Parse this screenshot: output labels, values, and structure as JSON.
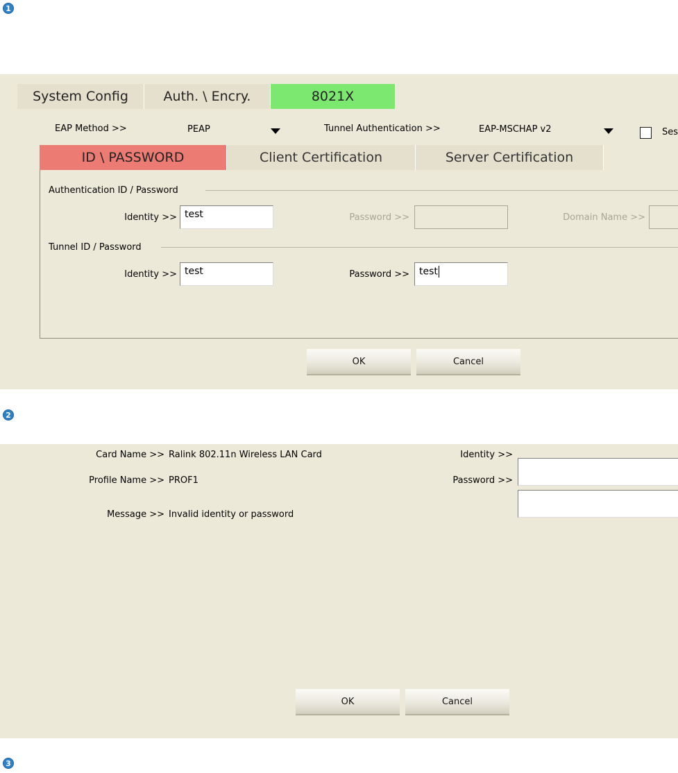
{
  "steps": [
    "1",
    "2",
    "3"
  ],
  "config_tabs": [
    "System Config",
    "Auth. \\ Encry.",
    "8021X"
  ],
  "eap": {
    "method_label": "EAP Method >>",
    "method_value": "PEAP",
    "tunnel_label": "Tunnel Authentication >>",
    "tunnel_value": "EAP-MSCHAP v2",
    "session_label": "Ses"
  },
  "sub_tabs": [
    "ID \\ PASSWORD",
    "Client Certification",
    "Server Certification"
  ],
  "auth_group": {
    "title": "Authentication ID / Password",
    "identity_label": "Identity >>",
    "identity_value": "test",
    "password_label": "Password >>",
    "password_value": "",
    "domain_label": "Domain Name >>",
    "domain_value": ""
  },
  "tunnel_group": {
    "title": "Tunnel ID / Password",
    "identity_label": "Identity >>",
    "identity_value": "test",
    "password_label": "Password >>",
    "password_value": "test"
  },
  "dialog1": {
    "ok": "OK",
    "cancel": "Cancel"
  },
  "dialog2": {
    "card_label": "Card Name >>",
    "card_value": "Ralink 802.11n Wireless LAN Card",
    "profile_label": "Profile Name >>",
    "profile_value": "PROF1",
    "message_label": "Message >>",
    "message_value": "Invalid identity or password",
    "identity_label": "Identity >>",
    "identity_value": "",
    "password_label": "Password >>",
    "password_value": "",
    "ok": "OK",
    "cancel": "Cancel"
  }
}
